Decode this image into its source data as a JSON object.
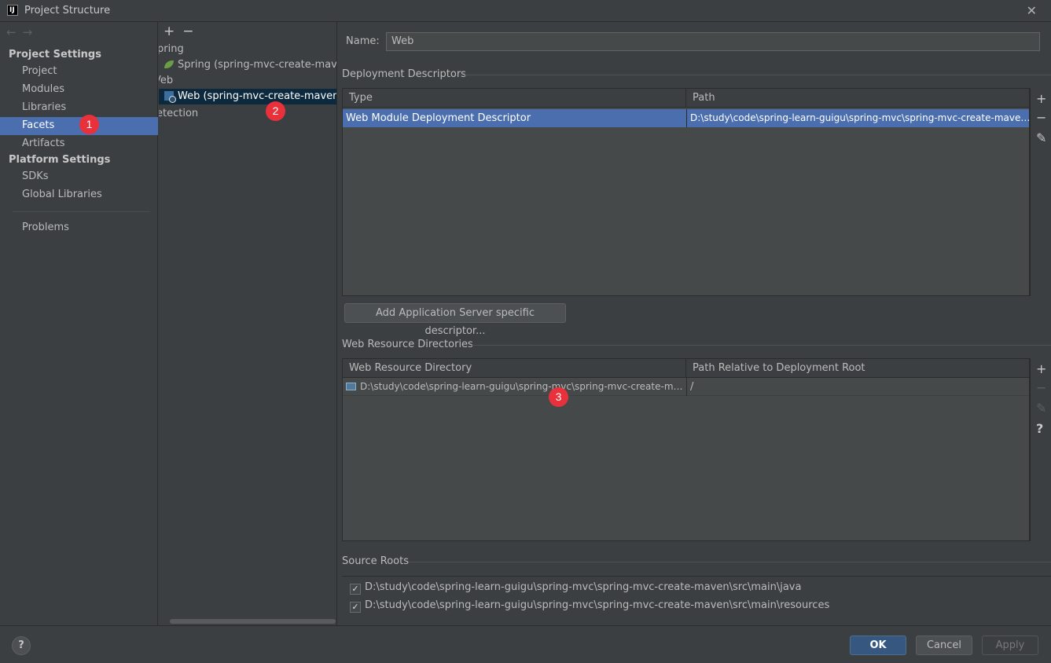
{
  "window": {
    "title": "Project Structure",
    "close": "✕"
  },
  "sidebar": {
    "nav_back": "←",
    "nav_forward": "→",
    "project_settings_header": "Project Settings",
    "platform_settings_header": "Platform Settings",
    "items": [
      "Project",
      "Modules",
      "Libraries",
      "Facets",
      "Artifacts"
    ],
    "platform_items": [
      "SDKs",
      "Global Libraries"
    ],
    "problems": "Problems",
    "selected": "Facets"
  },
  "tree": {
    "add": "+",
    "remove": "−",
    "rows": [
      "pring",
      "Spring (spring-mvc-create-maven)",
      "Veb",
      "Web (spring-mvc-create-maven)",
      "etection"
    ]
  },
  "content": {
    "name_label": "Name:",
    "name_value": "Web",
    "deployment_title": "Deployment Descriptors",
    "deployment_headers": [
      "Type",
      "Path"
    ],
    "deployment_rows": [
      {
        "type": "Web Module Deployment Descriptor",
        "path": "D:\\study\\code\\spring-learn-guigu\\spring-mvc\\spring-mvc-create-maven\\s"
      }
    ],
    "add_server_descriptor": "Add Application Server specific descriptor...",
    "web_resource_title": "Web Resource Directories",
    "web_resource_headers": [
      "Web Resource Directory",
      "Path Relative to Deployment Root"
    ],
    "web_resource_rows": [
      {
        "dir": "D:\\study\\code\\spring-learn-guigu\\spring-mvc\\spring-mvc-create-ma...",
        "path": "/"
      }
    ],
    "source_roots_title": "Source Roots",
    "source_roots": [
      "D:\\study\\code\\spring-learn-guigu\\spring-mvc\\spring-mvc-create-maven\\src\\main\\java",
      "D:\\study\\code\\spring-learn-guigu\\spring-mvc\\spring-mvc-create-maven\\src\\main\\resources"
    ],
    "tool_add": "+",
    "tool_remove": "−",
    "tool_edit": "✎",
    "tool_help": "?"
  },
  "badges": [
    "1",
    "2",
    "3"
  ],
  "footer": {
    "help": "?",
    "ok": "OK",
    "cancel": "Cancel",
    "apply": "Apply"
  },
  "colors": {
    "selection": "#4b6eaf",
    "badge": "#e8313a",
    "background": "#3c3f41"
  }
}
